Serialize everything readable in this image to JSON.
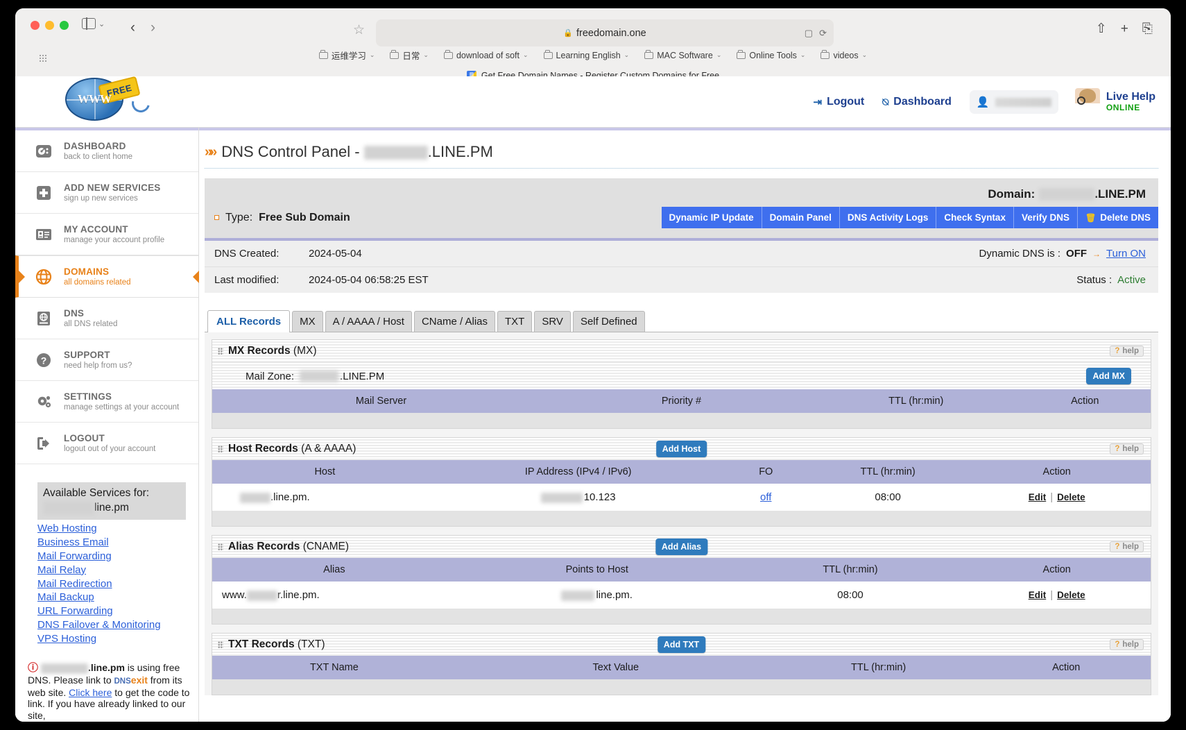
{
  "browser": {
    "url": "freedomain.one",
    "lock_icon": "lock-icon",
    "bookmarks": [
      {
        "label": "运维学习"
      },
      {
        "label": "日常"
      },
      {
        "label": "download of soft"
      },
      {
        "label": "Learning English"
      },
      {
        "label": "MAC Software"
      },
      {
        "label": "Online Tools"
      },
      {
        "label": "videos"
      }
    ],
    "tab_title": "Get Free Domain Names - Register Custom Domains for Free"
  },
  "header": {
    "logo_text": "WWW",
    "logo_badge": "FREE",
    "logout": "Logout",
    "dashboard": "Dashboard",
    "live_help_title": "Live Help",
    "live_help_status": "ONLINE"
  },
  "sidebar": {
    "items": [
      {
        "title": "DASHBOARD",
        "sub": "back to client home",
        "icon": "gauge-icon",
        "active": false
      },
      {
        "title": "ADD NEW SERVICES",
        "sub": "sign up new services",
        "icon": "plus-square-icon",
        "active": false
      },
      {
        "title": "MY ACCOUNT",
        "sub": "manage your account profile",
        "icon": "id-card-icon",
        "active": false
      },
      {
        "title": "DOMAINS",
        "sub": "all domains related",
        "icon": "globe-icon",
        "active": true
      },
      {
        "title": "DNS",
        "sub": "all DNS related",
        "icon": "dns-book-icon",
        "active": false
      },
      {
        "title": "SUPPORT",
        "sub": "need help from us?",
        "icon": "question-circle-icon",
        "active": false
      },
      {
        "title": "SETTINGS",
        "sub": "manage settings at your account",
        "icon": "gears-icon",
        "active": false
      },
      {
        "title": "LOGOUT",
        "sub": "logout out of your account",
        "icon": "logout-icon",
        "active": false
      }
    ],
    "services": {
      "heading_line1": "Available Services for:",
      "heading_line2_suffix": "line.pm",
      "links": [
        "Web Hosting",
        "Business Email",
        "Mail Forwarding",
        "Mail Relay",
        "Mail Redirection",
        "Mail Backup",
        "URL Forwarding",
        "DNS Failover & Monitoring",
        "VPS Hosting"
      ]
    },
    "dns_note": {
      "part1": ".line.pm",
      "part2": " is using free DNS. Please link to ",
      "brand_a": "DNS",
      "brand_b": "exit",
      "part3": " from its web site. ",
      "link": "Click here",
      "part4": " to get the code to link. If you have already linked to our site,"
    }
  },
  "main": {
    "breadcrumb_title_prefix": "DNS Control Panel - ",
    "breadcrumb_title_suffix": ".LINE.PM",
    "domain_label": "Domain:",
    "domain_suffix": ".LINE.PM",
    "type_label": "Type:",
    "type_value": "Free Sub Domain",
    "buttons": [
      "Dynamic IP Update",
      "Domain Panel",
      "DNS Activity Logs",
      "Check Syntax",
      "Verify DNS",
      "Delete DNS"
    ],
    "info": {
      "created_label": "DNS Created:",
      "created_value": "2024-05-04",
      "modified_label": "Last modified:",
      "modified_value": "2024-05-04 06:58:25 EST",
      "ddns_label": "Dynamic DNS is :",
      "ddns_value": "OFF",
      "ddns_action": "Turn ON",
      "status_label": "Status :",
      "status_value": "Active"
    },
    "tabs": [
      {
        "label": "ALL Records",
        "selected": true
      },
      {
        "label": "MX",
        "selected": false
      },
      {
        "label": "A / AAAA / Host",
        "selected": false
      },
      {
        "label": "CName / Alias",
        "selected": false
      },
      {
        "label": "TXT",
        "selected": false
      },
      {
        "label": "SRV",
        "selected": false
      },
      {
        "label": "Self Defined",
        "selected": false
      }
    ],
    "help_label": "help",
    "sections": [
      {
        "title_bold": "MX Records",
        "title_light": "(MX)",
        "add_button": "Add MX",
        "zone_label": "Mail Zone:",
        "zone_value": ".LINE.PM",
        "columns": [
          "Mail Server",
          "Priority #",
          "TTL (hr:min)",
          "Action"
        ],
        "rows": []
      },
      {
        "title_bold": "Host Records",
        "title_light": "(A & AAAA)",
        "add_button": "Add Host",
        "columns": [
          "Host",
          "IP Address (IPv4 / IPv6)",
          "FO",
          "TTL (hr:min)",
          "Action"
        ],
        "rows": [
          {
            "host": ".line.pm.",
            "ip": "10.123",
            "fo": "off",
            "ttl": "08:00",
            "edit": "Edit",
            "delete": "Delete"
          }
        ]
      },
      {
        "title_bold": "Alias Records",
        "title_light": "(CNAME)",
        "add_button": "Add Alias",
        "columns": [
          "Alias",
          "Points to Host",
          "TTL (hr:min)",
          "Action"
        ],
        "rows": [
          {
            "alias_prefix": "www.",
            "alias_suffix": "r.line.pm.",
            "points_to": "line.pm.",
            "ttl": "08:00",
            "edit": "Edit",
            "delete": "Delete"
          }
        ]
      },
      {
        "title_bold": "TXT Records",
        "title_light": "(TXT)",
        "add_button": "Add TXT",
        "columns": [
          "TXT Name",
          "Text Value",
          "TTL (hr:min)",
          "Action"
        ],
        "rows": []
      }
    ]
  }
}
